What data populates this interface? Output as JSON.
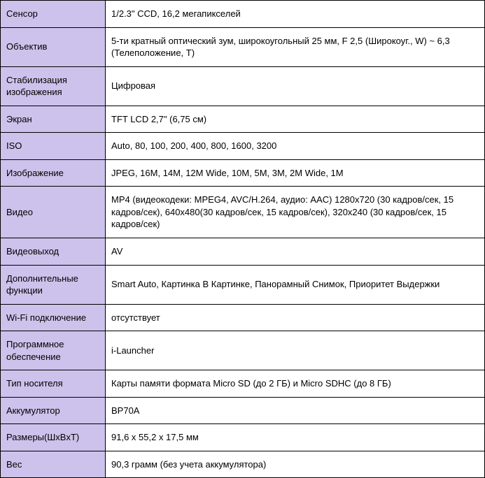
{
  "spec": {
    "rows": [
      {
        "label": "Сенсор",
        "value": "1/2.3\" CCD, 16,2 мегапикселей"
      },
      {
        "label": "Объектив",
        "value": "5-ти кратный оптический зум, широкоугольный 25 мм, F 2,5 (Широкоуг., W) ~ 6,3 (Телеположение, T)"
      },
      {
        "label": "Стабилизация изображения",
        "value": "Цифровая"
      },
      {
        "label": "Экран",
        "value": "TFT LCD 2,7\" (6,75 см)"
      },
      {
        "label": "ISO",
        "value": "Auto, 80, 100, 200, 400, 800, 1600, 3200"
      },
      {
        "label": "Изображение",
        "value": "JPEG, 16M, 14M, 12M Wide, 10M, 5M, 3M, 2M Wide, 1M"
      },
      {
        "label": "Видео",
        "value": "MP4 (видеокодеки: MPEG4, AVC/H.264, аудио: AAC)\n1280x720 (30 кадров/сек, 15 кадров/сек), 640x480(30 кадров/сек, 15 кадров/сек), 320x240 (30 кадров/сек, 15 кадров/сек)"
      },
      {
        "label": "Видеовыход",
        "value": "AV"
      },
      {
        "label": "Дополнительные функции",
        "value": "Smart Auto, Картинка В Картинке, Панорамный Снимок, Приоритет Выдержки"
      },
      {
        "label": "Wi-Fi подключение",
        "value": "отсутствует"
      },
      {
        "label": "Программное обеспечение",
        "value": "i-Launcher"
      },
      {
        "label": "Тип носителя",
        "value": "Карты памяти формата Micro SD (до 2 ГБ) и Micro SDHC (до 8 ГБ)"
      },
      {
        "label": "Аккумулятор",
        "value": "BP70A"
      },
      {
        "label": "Размеры(ШxВxТ)",
        "value": "91,6 x 55,2 x 17,5 мм"
      },
      {
        "label": "Вес",
        "value": "90,3 грамм (без учета аккумулятора)"
      }
    ]
  }
}
